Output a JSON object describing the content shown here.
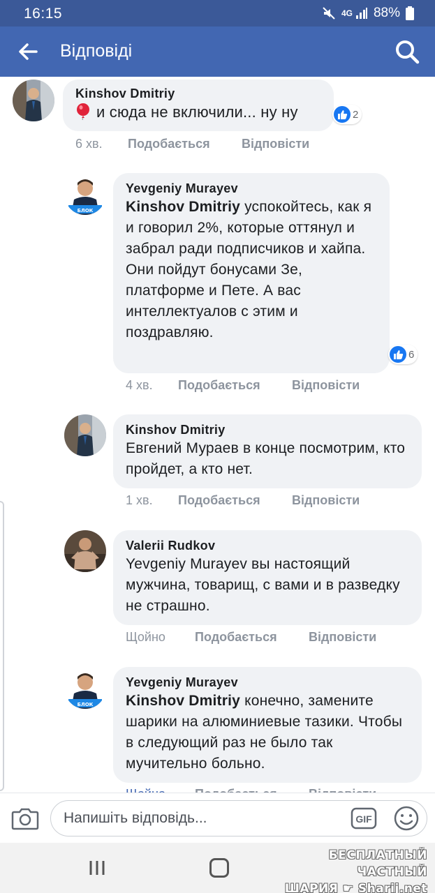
{
  "status_bar": {
    "time": "16:15",
    "network": "4G",
    "battery": "88%"
  },
  "app_bar": {
    "title": "Відповіді"
  },
  "comments": [
    {
      "author": "Kinshov Dmitriy",
      "mention": "",
      "text": "и сюда не включили... ну ну",
      "reactions": "2",
      "time": "6 хв.",
      "like": "Подобається",
      "reply": "Відповісти"
    },
    {
      "author": "Yevgeniy  Murayev",
      "mention": "Kinshov Dmitriy",
      "text": " успокойтесь, как я и говорил 2%, которые оттянул и забрал ради подписчиков и хайпа. Они пойдут бонусами Зе, платформе и Пете. А вас интеллектуалов с этим и поздравляю.",
      "reactions": "6",
      "time": "4 хв.",
      "like": "Подобається",
      "reply": "Відповісти"
    },
    {
      "author": "Kinshov Dmitriy",
      "mention": "",
      "text": "Евгений Мураев в конце посмотрим, кто пройдет, а кто нет.",
      "time": "1 хв.",
      "like": "Подобається",
      "reply": "Відповісти"
    },
    {
      "author": "Valerii Rudkov",
      "mention": "",
      "text": "Yevgeniy  Murayev вы настоящий мужчина,  товарищ,  с вами и в разведку не страшно.",
      "time": "Щойно",
      "like": "Подобається",
      "reply": "Відповісти"
    },
    {
      "author": "Yevgeniy  Murayev",
      "mention": "Kinshov Dmitriy",
      "text": " конечно, замените шарики на алюминиевые тазики. Чтобы в следующий раз не было так мучительно больно.",
      "time": "Щойно",
      "like": "Подобається",
      "reply": "Відповісти"
    }
  ],
  "composer": {
    "placeholder": "Напишіть відповідь...",
    "gif_label": "GIF"
  },
  "watermark": {
    "line1": "БЕСПЛАТНЫЙ ЧАСТНЫЙ",
    "line2": "ШАРИЯ",
    "line3": "Sharij.net"
  },
  "colors": {
    "status_bar": "#3b5998",
    "app_bar": "#4267b2",
    "bubble": "#f0f2f5",
    "like_blue": "#1877f2",
    "muted_text": "#8d949e"
  }
}
